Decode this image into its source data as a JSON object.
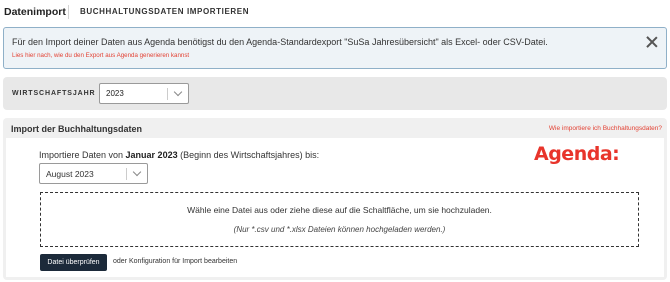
{
  "header": {
    "brand": "Datenimport",
    "title": "BUCHHALTUNGSDATEN IMPORTIEREN"
  },
  "info": {
    "text": "Für den Import deiner Daten aus Agenda benötigst du den Agenda-Standardexport \"SuSa Jahresübersicht\" als Excel- oder CSV-Datei.",
    "link": "Lies hier nach, wie du den Export aus Agenda generieren kannst"
  },
  "fiscal_year": {
    "label": "WIRTSCHAFTSJAHR",
    "selected": "2023"
  },
  "import_panel": {
    "title": "Import der Buchhaltungsdaten",
    "help_link": "Wie importiere ich Buchhaltungsdaten?",
    "text_prefix": "Importiere Daten von ",
    "start_month": "Januar 2023",
    "text_suffix": " (Beginn des Wirtschaftsjahres) bis:",
    "logo": "Agenda:",
    "month_selected": "August 2023",
    "drop_main": "Wähle eine Datei aus oder ziehe diese auf die Schaltfläche, um sie hochzuladen.",
    "drop_sub": "(Nur *.csv und *.xlsx Dateien können hochgeladen werden.)",
    "check_button": "Datei überprüfen",
    "alt_link": "oder Konfiguration für Import bearbeiten"
  },
  "colors": {
    "accent": "#e34234",
    "button": "#1c2a3a",
    "info_bg": "#eef3f7"
  }
}
